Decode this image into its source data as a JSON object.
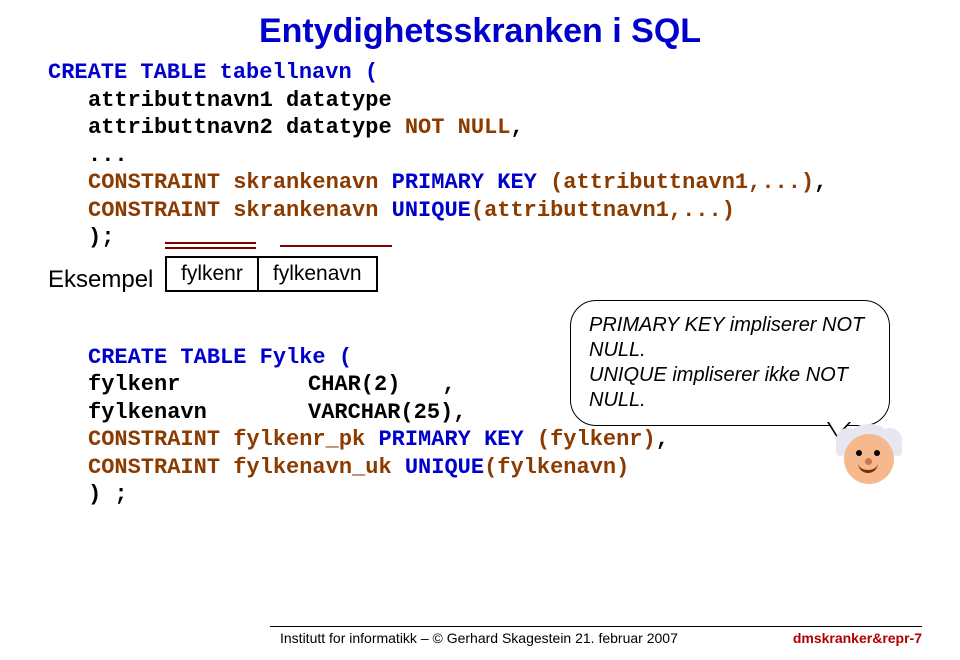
{
  "title": "Entydighetsskranken i SQL",
  "create_table": "CREATE TABLE tabellnavn (",
  "attr1": "attributtnavn1 datatype",
  "attr2_pre": "attributtnavn2 datatype",
  "not_null": " NOT NULL",
  "comma": ",",
  "ellipsis": "...",
  "pk_constraint_a": "CONSTRAINT skrankenavn ",
  "pk_constraint_b": "PRIMARY KEY ",
  "pk_constraint_c": "(attributtnavn1,...)",
  "pk_constraint_d": ",",
  "uq_constraint_a": "CONSTRAINT skrankenavn ",
  "uq_constraint_b": "UNIQUE",
  "uq_constraint_c": "(attributtnavn1,...)",
  "close_paren": ");",
  "example_label": "Eksempel",
  "tbl": {
    "c1": "fylkenr",
    "c2": "fylkenavn"
  },
  "speech": "PRIMARY KEY impliserer NOT NULL.\nUNIQUE impliserer ikke NOT NULL.",
  "ex": {
    "create": "CREATE TABLE Fylke (",
    "l1a": "fylkenr",
    "l1b": "CHAR(2)",
    "l1c": " ,",
    "l2a": "fylkenavn",
    "l2b": "VARCHAR(25),",
    "l3a": "CONSTRAINT fylkenr_pk ",
    "l3b": "PRIMARY KEY ",
    "l3c": "(fylkenr)",
    "l3d": ",",
    "l4a": "CONSTRAINT fylkenavn_uk ",
    "l4b": "UNIQUE",
    "l4c": "(fylkenavn)",
    "end": ") ;"
  },
  "footer": {
    "left": "Institutt for informatikk – © Gerhard Skagestein 21. februar 2007",
    "right": "dmskranker&repr-7"
  }
}
